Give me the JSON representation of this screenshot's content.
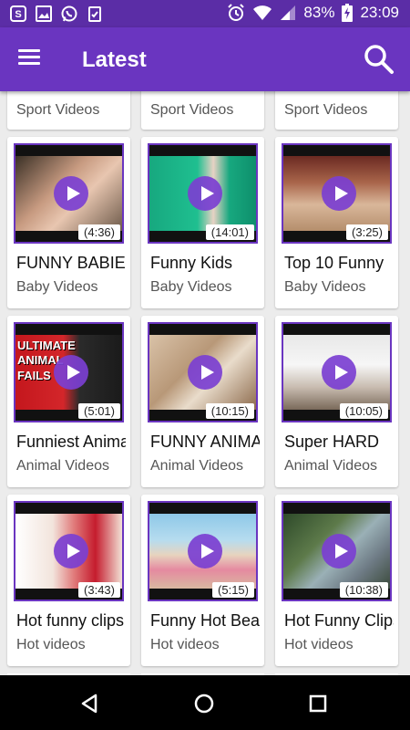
{
  "status_bar": {
    "battery": "83%",
    "time": "23:09",
    "left_icons": [
      "skype-icon",
      "gallery-icon",
      "whatsapp-icon",
      "clipboard-icon"
    ]
  },
  "app_bar": {
    "title": "Latest"
  },
  "partial_row": [
    "Sport Videos",
    "Sport Videos",
    "Sport Videos"
  ],
  "videos": [
    {
      "title": "FUNNY BABIES",
      "category": "Baby Videos",
      "duration": "(4:36)"
    },
    {
      "title": "Funny Kids",
      "category": "Baby Videos",
      "duration": "(14:01)"
    },
    {
      "title": "Top 10 Funny",
      "category": "Baby Videos",
      "duration": "(3:25)"
    },
    {
      "title": "Funniest Animals",
      "category": "Animal Videos",
      "duration": "(5:01)"
    },
    {
      "title": "FUNNY ANIMALS",
      "category": "Animal Videos",
      "duration": "(10:15)"
    },
    {
      "title": "Super HARD",
      "category": "Animal Videos",
      "duration": "(10:05)"
    },
    {
      "title": "Hot funny clips",
      "category": "Hot videos",
      "duration": "(3:43)"
    },
    {
      "title": "Funny Hot Beach",
      "category": "Hot videos",
      "duration": "(5:15)"
    },
    {
      "title": "Hot Funny Clips",
      "category": "Hot videos",
      "duration": "(10:38)"
    }
  ],
  "thumb_overlay_text": "ULTIMATE ANIMAL FAILS",
  "colors": {
    "primary": "#6a35c0",
    "status": "#5b2da6",
    "play": "#7b3fd1"
  }
}
